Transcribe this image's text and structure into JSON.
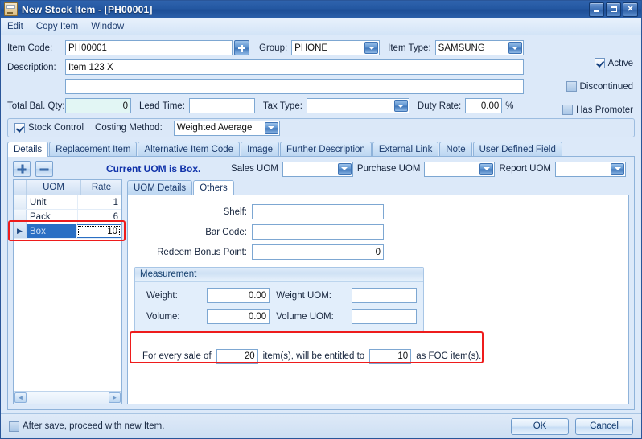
{
  "window": {
    "title": "New Stock Item - [PH00001]",
    "icon": "stock-item-icon",
    "minimize": "_",
    "maximize": "□",
    "close": "✕"
  },
  "menubar": {
    "items": [
      "Edit",
      "Copy Item",
      "Window"
    ]
  },
  "form": {
    "item_code_label": "Item Code:",
    "item_code_value": "PH00001",
    "item_code_lookup": "add-icon",
    "group_label": "Group:",
    "group_value": "PHONE",
    "item_type_label": "Item Type:",
    "item_type_value": "SAMSUNG",
    "description_label": "Description:",
    "description_line1": "Item 123 X",
    "description_line2": "",
    "total_bal_qty_label": "Total Bal. Qty:",
    "total_bal_qty_value": "0",
    "lead_time_label": "Lead Time:",
    "lead_time_value": "",
    "tax_type_label": "Tax Type:",
    "tax_type_value": "",
    "duty_rate_label": "Duty Rate:",
    "duty_rate_value": "0.00",
    "duty_rate_suffix": "%",
    "active_label": "Active",
    "active_checked": true,
    "discontinued_label": "Discontinued",
    "discontinued_checked": false,
    "has_promoter_label": "Has Promoter",
    "has_promoter_checked": false,
    "stock_control_label": "Stock Control",
    "stock_control_checked": true,
    "costing_method_label": "Costing Method:",
    "costing_method_value": "Weighted Average"
  },
  "tabs": {
    "items": [
      {
        "label": "Details",
        "active": true
      },
      {
        "label": "Replacement Item",
        "active": false
      },
      {
        "label": "Alternative Item Code",
        "active": false
      },
      {
        "label": "Image",
        "active": false
      },
      {
        "label": "Further Description",
        "active": false
      },
      {
        "label": "External Link",
        "active": false
      },
      {
        "label": "Note",
        "active": false
      },
      {
        "label": "User Defined Field",
        "active": false
      }
    ]
  },
  "uom_toolbar": {
    "add_button": "plus-icon",
    "remove_button": "minus-icon",
    "current_uom_text": "Current UOM is Box.",
    "sales_uom_label": "Sales UOM",
    "sales_uom_value": "",
    "purchase_uom_label": "Purchase UOM",
    "purchase_uom_value": "",
    "report_uom_label": "Report UOM",
    "report_uom_value": ""
  },
  "uom_grid": {
    "columns": [
      "UOM",
      "Rate"
    ],
    "rows": [
      {
        "uom": "Unit",
        "rate": "1",
        "selected": false
      },
      {
        "uom": "Pack",
        "rate": "6",
        "selected": false
      },
      {
        "uom": "Box",
        "rate": "10",
        "selected": true
      }
    ],
    "scroll_left": "◄",
    "scroll_right": "►"
  },
  "inner_tabs": {
    "items": [
      {
        "label": "UOM Details",
        "active": false
      },
      {
        "label": "Others",
        "active": true
      }
    ]
  },
  "others_panel": {
    "shelf_label": "Shelf:",
    "shelf_value": "",
    "bar_code_label": "Bar Code:",
    "bar_code_value": "",
    "redeem_bonus_point_label": "Redeem Bonus Point:",
    "redeem_bonus_point_value": "0",
    "measurement_title": "Measurement",
    "weight_label": "Weight:",
    "weight_value": "0.00",
    "weight_uom_label": "Weight UOM:",
    "weight_uom_value": "",
    "volume_label": "Volume:",
    "volume_value": "0.00",
    "volume_uom_label": "Volume UOM:",
    "volume_uom_value": "",
    "foc_prefix": "For every sale of",
    "foc_qty_value": "20",
    "foc_middle": "item(s), will be entitled to",
    "foc_free_value": "10",
    "foc_suffix": "as FOC item(s)."
  },
  "footer": {
    "after_save_label": "After save, proceed with new Item.",
    "after_save_checked": false,
    "ok_label": "OK",
    "cancel_label": "Cancel"
  },
  "colors": {
    "titlebar": "#24589f",
    "window_bg": "#dce9f9",
    "accent_text": "#1133aa",
    "highlight_red": "#ee1c1c",
    "selection_blue": "#2a6fc4"
  }
}
